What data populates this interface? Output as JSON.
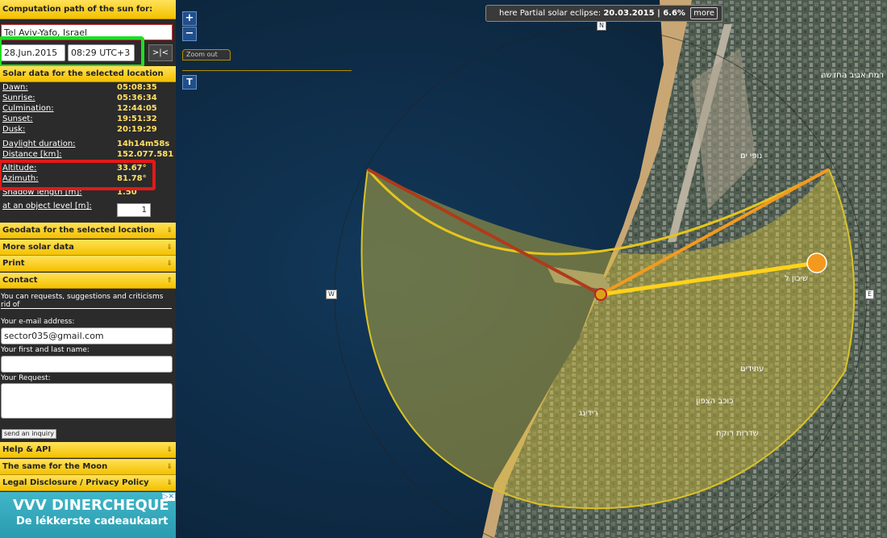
{
  "sidebar": {
    "title": "Computation path of the sun for:",
    "location": "Tel Aviv-Yafo, Israel",
    "date": "28.Jun.2015",
    "time": "08:29 UTC+3",
    "reset_label": ">|<",
    "solar_header": "Solar data for the selected location",
    "rows": [
      {
        "label": "Dawn:",
        "value": "05:08:35"
      },
      {
        "label": "Sunrise:",
        "value": "05:36:34"
      },
      {
        "label": "Culmination:",
        "value": "12:44:05"
      },
      {
        "label": "Sunset:",
        "value": "19:51:32"
      },
      {
        "label": "Dusk:",
        "value": "20:19:29"
      },
      {
        "label": "Daylight duration:",
        "value": "14h14m58s"
      },
      {
        "label": "Distance [km]:",
        "value": "152.077.581"
      },
      {
        "label": "Altitude:",
        "value": "33.67°"
      },
      {
        "label": "Azimuth:",
        "value": "81.78°"
      },
      {
        "label": "Shadow length [m]:",
        "value": "1.50"
      },
      {
        "label": "at an object level [m]:",
        "value": ""
      }
    ],
    "object_level": "1",
    "sections": {
      "geodata": "Geodata for the selected location",
      "more_solar": "More solar data",
      "print": "Print",
      "contact": "Contact"
    },
    "contact": {
      "intro": "You can requests, suggestions and criticisms rid of",
      "email_label": "Your e-mail address:",
      "email_value": "sector035@gmail.com",
      "name_label": "Your first and last name:",
      "request_label": "Your Request:",
      "send_label": "send an inquiry"
    },
    "bottom_sections": {
      "help": "Help & API",
      "moon": "The same for the Moon",
      "legal": "Legal Disclosure / Privacy Policy"
    },
    "ad": {
      "line1": "VVV DINERCHEQUE",
      "line2": "De lékkerste cadeaukaart"
    }
  },
  "map": {
    "zoom_in": "+",
    "zoom_out": "−",
    "zoom_out_tab": "Zoom out",
    "t_button": "T",
    "eclipse_prefix": "here Partial solar eclipse:",
    "eclipse_value": "20.03.2015 | 6.6%",
    "eclipse_more": "more",
    "compass": {
      "n": "N",
      "w": "W",
      "e": "E"
    },
    "labels": [
      "רמת אביב החדשה",
      "נופי ים",
      "שיכון ל",
      "כוכב הצפון",
      "עתידים",
      "שדרות רוקח",
      "רידינג"
    ]
  },
  "colors": {
    "accent_yellow": "#f4c100",
    "sun_orange": "#f39a1e",
    "sunset_red": "#b03a1a",
    "sun_line": "#ffd21a"
  }
}
